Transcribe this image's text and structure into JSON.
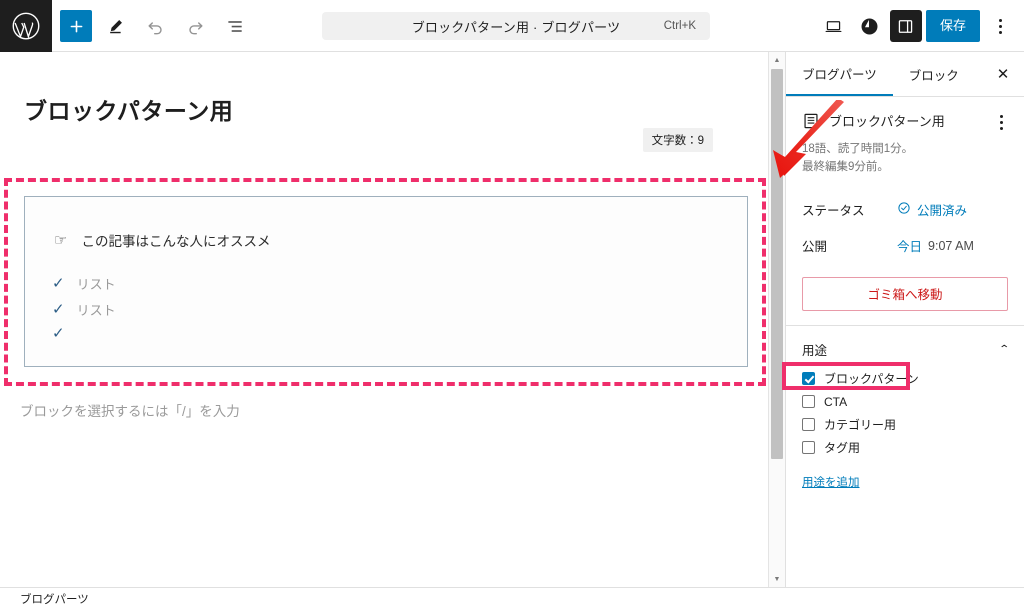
{
  "topbar": {
    "logo_icon": "wordpress-logo",
    "add_block_label": "+",
    "tools": [
      {
        "name": "add-block-button",
        "icon": "plus-icon"
      },
      {
        "name": "edit-tool-button",
        "icon": "pencil-icon"
      },
      {
        "name": "undo-button",
        "icon": "undo-arrow-icon"
      },
      {
        "name": "redo-button",
        "icon": "redo-arrow-icon"
      },
      {
        "name": "list-view-button",
        "icon": "document-overview-icon"
      }
    ],
    "command_bar": {
      "title": "ブロックパターン用 · ブログパーツ",
      "shortcut": "Ctrl+K"
    },
    "view_icon": "desktop-preview-icon",
    "jetpack_icon": "jetpack-icon",
    "sidebar_toggle_icon": "settings-sidebar-icon",
    "save_label": "保存",
    "options_icon": "kebab-menu-icon"
  },
  "editor": {
    "post_title": "ブロックパターン用",
    "word_count_badge": "文字数：9",
    "block": {
      "recommend_icon": "☞",
      "recommend_text": "この記事はこんな人にオススメ",
      "list_items": [
        {
          "check": "✓",
          "text": "リスト"
        },
        {
          "check": "✓",
          "text": "リスト"
        },
        {
          "check": "✓",
          "text": ""
        }
      ]
    },
    "paragraph_placeholder": "ブロックを選択するには「/」を入力"
  },
  "sidebar": {
    "tabs": [
      {
        "label": "ブログパーツ",
        "active": true
      },
      {
        "label": "ブロック",
        "active": false
      }
    ],
    "close_icon": "close-icon",
    "document": {
      "icon": "document-icon",
      "name": "ブロックパターン用",
      "options_icon": "kebab-menu-icon",
      "meta_line1": "18語、読了時間1分。",
      "meta_line2": "最終編集9分前。"
    },
    "status_row": {
      "label": "ステータス",
      "icon": "published-check-icon",
      "value": "公開済み"
    },
    "publish_row": {
      "label": "公開",
      "value_link": "今日",
      "value_time": "9:07 AM"
    },
    "trash_label": "ゴミ箱へ移動",
    "usage_section": {
      "title": "用途",
      "collapse_icon": "chevron-up-icon",
      "terms": [
        {
          "label": "ブロックパターン",
          "checked": true,
          "highlighted": true
        },
        {
          "label": "CTA",
          "checked": false,
          "highlighted": false
        },
        {
          "label": "カテゴリー用",
          "checked": false,
          "highlighted": false
        },
        {
          "label": "タグ用",
          "checked": false,
          "highlighted": false
        }
      ],
      "add_link": "用途を追加"
    }
  },
  "bottombar": {
    "breadcrumb": "ブログパーツ"
  },
  "annotations": {
    "highlight_color": "#ef2e6b",
    "arrow_color": "#e8231f",
    "arrow_name": "red-pointer-arrow",
    "dashed_box_name": "selected-pattern-highlight"
  },
  "colors": {
    "accent": "#007cba",
    "danger": "#cc1818",
    "pink": "#ef2e6b"
  }
}
